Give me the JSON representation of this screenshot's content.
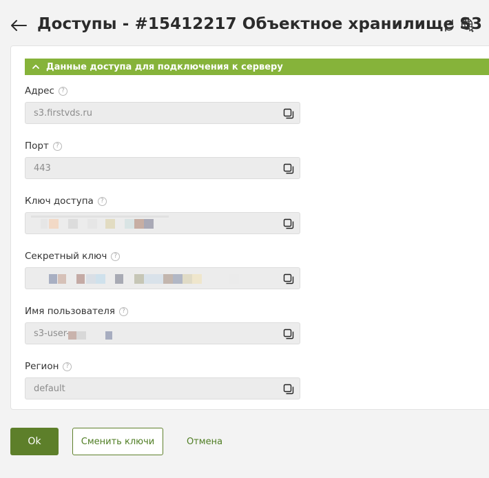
{
  "header": {
    "title": "Доступы - #15412217 Объектное хранилище S3",
    "back_icon": "arrow-left-icon",
    "refresh_icon": "refresh-icon",
    "globe_icon": "globe-link-icon"
  },
  "section": {
    "title": "Данные доступа для подключения к серверу",
    "icon": "chevron-up-icon",
    "color": "#86b33a"
  },
  "fields": [
    {
      "label": "Адрес",
      "help": "?",
      "value": "s3.firstvds.ru"
    },
    {
      "label": "Порт",
      "help": "?",
      "value": "443"
    },
    {
      "label": "Ключ доступа",
      "help": "?",
      "value": ""
    },
    {
      "label": "Секретный ключ",
      "help": "?",
      "value": ""
    },
    {
      "label": "Имя пользователя",
      "help": "?",
      "value": "s3-user-"
    },
    {
      "label": "Регион",
      "help": "?",
      "value": "default"
    }
  ],
  "buttons": {
    "ok": "Ok",
    "change_keys": "Сменить ключи",
    "cancel": "Отмена"
  },
  "colors": {
    "primary": "#5d7f2a",
    "accent": "#86b33a",
    "link": "#4f7d23"
  }
}
